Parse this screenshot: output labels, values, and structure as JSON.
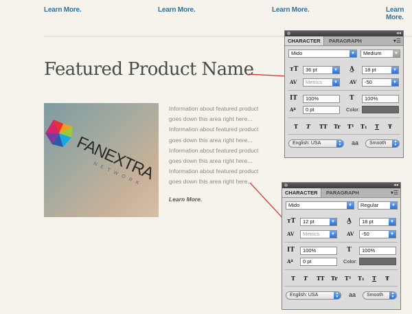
{
  "top_links": [
    "Learn More.",
    "Learn More.",
    "Learn More.",
    "Learn More."
  ],
  "product": {
    "title": "Featured Product Name",
    "logo_text": "FANEXTRA",
    "logo_sub": "NETWORK",
    "info_lines": [
      "Information about featured product",
      "goes down this area right here...",
      "Information about featured product",
      "goes down this area right here...",
      "Information about featured product",
      "goes down this area right here...",
      "Information about featured product",
      "goes down this area right here..."
    ],
    "learn_more": "Learn More."
  },
  "panels": [
    {
      "tab_character": "CHARACTER",
      "tab_paragraph": "PARAGRAPH",
      "font_family": "Mido",
      "font_style": "Medium",
      "font_size": "36 pt",
      "leading": "18 pt",
      "kerning": "Metrics",
      "tracking": "-50",
      "vertical_scale": "100%",
      "horizontal_scale": "100%",
      "baseline_shift": "0 pt",
      "color_label": "Color:",
      "language": "English: USA",
      "aa_icon": "aa",
      "antialias": "Smooth"
    },
    {
      "tab_character": "CHARACTER",
      "tab_paragraph": "PARAGRAPH",
      "font_family": "Mido",
      "font_style": "Regular",
      "font_size": "12 pt",
      "leading": "18 pt",
      "kerning": "Metrics",
      "tracking": "-50",
      "vertical_scale": "100%",
      "horizontal_scale": "100%",
      "baseline_shift": "0 pt",
      "color_label": "Color:",
      "language": "English: USA",
      "aa_icon": "aa",
      "antialias": "Smooth"
    }
  ],
  "type_buttons": [
    "T",
    "T",
    "TT",
    "Tr",
    "T¹",
    "T₁",
    "T",
    "Ŧ"
  ]
}
